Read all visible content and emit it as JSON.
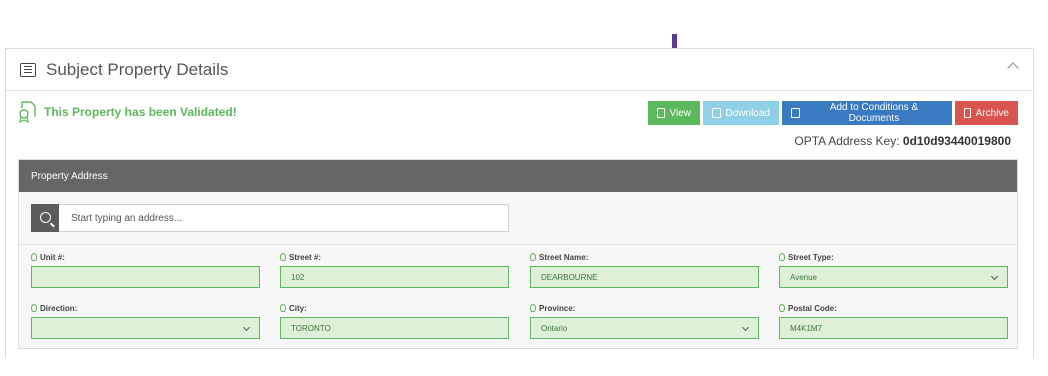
{
  "panel": {
    "title": "Subject Property Details",
    "validated_text": "This Property has been Validated!"
  },
  "actions": {
    "view": "View",
    "download": "Download",
    "add": "Add to Conditions & Documents",
    "archive": "Archive"
  },
  "opta": {
    "label": "OPTA Address Key: ",
    "value": "0d10d93440019800"
  },
  "address": {
    "header": "Property Address",
    "search_placeholder": "Start typing an address...",
    "fields": {
      "unit": {
        "label": "Unit #:",
        "value": ""
      },
      "street_no": {
        "label": "Street #:",
        "value": "102"
      },
      "street_name": {
        "label": "Street Name:",
        "value": "DEARBOURNE"
      },
      "street_type": {
        "label": "Street Type:",
        "value": "Avenue"
      },
      "direction": {
        "label": "Direction:",
        "value": ""
      },
      "city": {
        "label": "City:",
        "value": "TORONTO"
      },
      "province": {
        "label": "Province:",
        "value": "Ontario"
      },
      "postal": {
        "label": "Postal Code:",
        "value": "M4K1M7"
      }
    }
  },
  "colors": {
    "success": "#5cb85c",
    "info": "#8fd0e8",
    "primary": "#3a7ac2",
    "danger": "#d9534f",
    "arrow": "#5b3a8e"
  }
}
